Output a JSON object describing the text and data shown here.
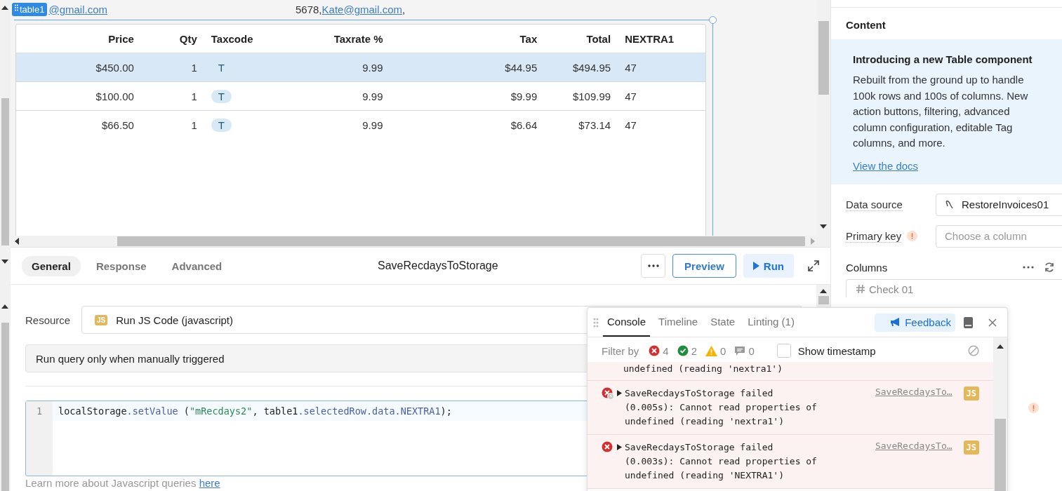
{
  "canvas": {
    "component_badge": "table1",
    "header_texts": [
      {
        "text": "@gmail.com",
        "kind": "link"
      },
      {
        "text": "5678, ",
        "kind": "text"
      },
      {
        "text": "Kate@gmail.com",
        "kind": "link"
      },
      {
        "text": ",",
        "kind": "text"
      }
    ],
    "table": {
      "columns": [
        "Price",
        "Qty",
        "Taxcode",
        "Taxrate %",
        "Tax",
        "Total",
        "NEXTRA1"
      ],
      "rows": [
        {
          "selected": true,
          "cells": [
            "$450.00",
            "1",
            "T",
            "9.99",
            "$44.95",
            "$494.95",
            "47"
          ]
        },
        {
          "selected": false,
          "cells": [
            "$100.00",
            "1",
            "T",
            "9.99",
            "$9.99",
            "$109.99",
            "47"
          ]
        },
        {
          "selected": false,
          "cells": [
            "$66.50",
            "1",
            "T",
            "9.99",
            "$6.64",
            "$73.14",
            "47"
          ]
        }
      ]
    }
  },
  "query": {
    "tabs": [
      {
        "label": "General",
        "selected": true
      },
      {
        "label": "Response",
        "selected": false
      },
      {
        "label": "Advanced",
        "selected": false
      }
    ],
    "title": "SaveRecdaysToStorage",
    "buttons": {
      "preview": "Preview",
      "run": "Run"
    },
    "resource_label": "Resource",
    "resource_badge": "JS",
    "resource": "Run JS Code (javascript)",
    "trigger": "Run query only when manually triggered",
    "code_lines": [
      {
        "number": "1",
        "tokens": [
          {
            "text": "localStorage",
            "kind": "plain"
          },
          {
            "text": ".setValue",
            "kind": "method"
          },
          {
            "text": " (",
            "kind": "plain"
          },
          {
            "text": "\"mRecdays2\"",
            "kind": "string"
          },
          {
            "text": ", table1",
            "kind": "plain"
          },
          {
            "text": ".selectedRow.data.NEXTRA1",
            "kind": "method"
          },
          {
            "text": ");",
            "kind": "plain"
          }
        ]
      }
    ],
    "footer": "Learn more about Javascript queries",
    "footer_link": "here"
  },
  "inspector": {
    "section": "Content",
    "notice": {
      "title": "Introducing a new Table component",
      "body": "Rebuilt from the ground up to handle 100k rows and 100s of columns. New action buttons, filtering, advanced column configuration, editable Tag columns, and more.",
      "link": "View the docs"
    },
    "data_source_label": "Data source",
    "data_source": "RestoreInvoices01",
    "primary_key_label": "Primary key",
    "primary_key_placeholder": "Choose a column",
    "columns_label": "Columns",
    "column_item": "Check 01"
  },
  "console": {
    "tabs": [
      {
        "label": "Console",
        "selected": true
      },
      {
        "label": "Timeline",
        "selected": false
      },
      {
        "label": "State",
        "selected": false
      },
      {
        "label": "Linting (1)",
        "selected": false
      }
    ],
    "feedback": "Feedback",
    "filter_label": "Filter by",
    "filters": [
      {
        "kind": "error",
        "count": "4"
      },
      {
        "kind": "success",
        "count": "2"
      },
      {
        "kind": "warning",
        "count": "0"
      },
      {
        "kind": "message",
        "count": "0"
      }
    ],
    "timestamp": {
      "label": "Show timestamp",
      "checked": false
    },
    "entries": [
      {
        "kind": "tail",
        "lines": [
          "undefined (reading 'nextra1')"
        ]
      },
      {
        "kind": "error",
        "queued": true,
        "lines": [
          "SaveRecdaysToStorage failed",
          "(0.005s): Cannot read properties of",
          "undefined (reading 'nextra1')"
        ],
        "source": "SaveRecdaysTo…",
        "badge": "JS"
      },
      {
        "kind": "error",
        "queued": false,
        "lines": [
          "SaveRecdaysToStorage failed",
          "(0.003s): Cannot read properties of",
          "undefined (reading 'NEXTRA1')"
        ],
        "source": "SaveRecdaysTo…",
        "badge": "JS"
      }
    ]
  }
}
